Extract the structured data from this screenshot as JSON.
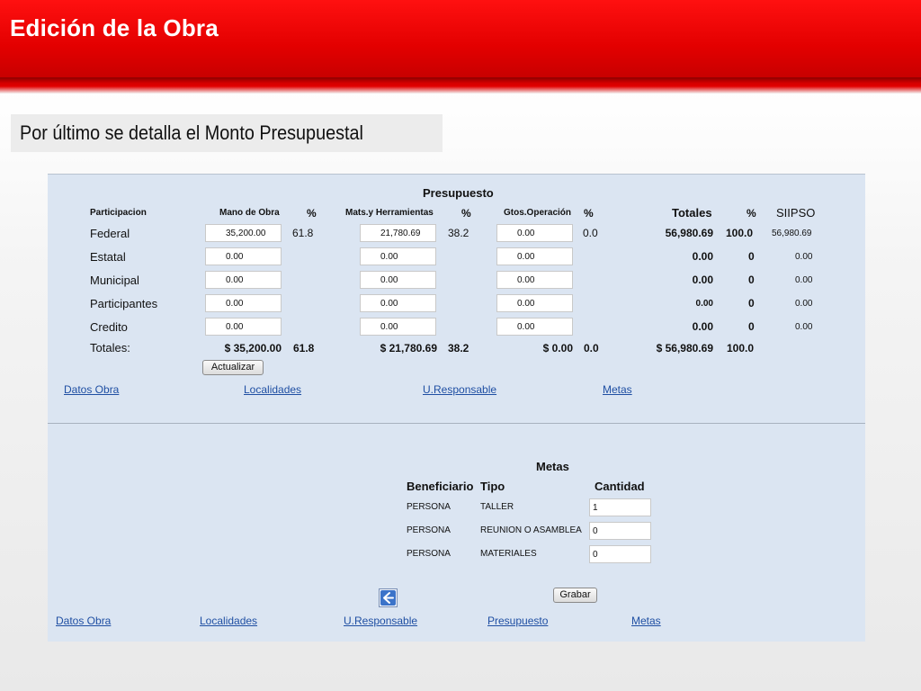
{
  "header": {
    "title": "Edición de la Obra"
  },
  "subtitle": "Por último se detalla el Monto Presupuestal",
  "presupuesto": {
    "title": "Presupuesto",
    "columns": {
      "participacion": "Participacion",
      "mano_obra": "Mano de Obra",
      "pct1": "%",
      "mats": "Mats.y Herramientas",
      "pct2": "%",
      "gtos": "Gtos.Operación",
      "pct3": "%",
      "totales": "Totales",
      "pct4": "%",
      "siipso": "SIIPSO"
    },
    "rows": [
      {
        "label": "Federal",
        "mano_obra": "35,200.00",
        "pct1": "61.8",
        "mats": "21,780.69",
        "pct2": "38.2",
        "gtos": "0.00",
        "pct3": "0.0",
        "total": "56,980.69",
        "pct4": "100.0",
        "siipso": "56,980.69"
      },
      {
        "label": "Estatal",
        "mano_obra": "0.00",
        "mats": "0.00",
        "gtos": "0.00",
        "total": "0.00",
        "pct4": "0",
        "siipso": "0.00"
      },
      {
        "label": "Municipal",
        "mano_obra": "0.00",
        "mats": "0.00",
        "gtos": "0.00",
        "total": "0.00",
        "pct4": "0",
        "siipso": "0.00"
      },
      {
        "label": "Participantes",
        "mano_obra": "0.00",
        "mats": "0.00",
        "gtos": "0.00",
        "total": "0.00",
        "pct4": "0",
        "siipso": "0.00"
      },
      {
        "label": "Credito",
        "mano_obra": "0.00",
        "mats": "0.00",
        "gtos": "0.00",
        "total": "0.00",
        "pct4": "0",
        "siipso": "0.00"
      }
    ],
    "totals": {
      "label": "Totales:",
      "mano_obra": "$ 35,200.00",
      "pct1": "61.8",
      "mats": "$ 21,780.69",
      "pct2": "38.2",
      "gtos": "$ 0.00",
      "pct3": "0.0",
      "total": "$ 56,980.69",
      "pct4": "100.0"
    },
    "update_button": "Actualizar",
    "links": [
      "Datos Obra",
      "Localidades",
      "U.Responsable",
      "Metas"
    ]
  },
  "metas": {
    "title": "Metas",
    "columns": {
      "beneficiario": "Beneficiario",
      "tipo": "Tipo",
      "cantidad": "Cantidad"
    },
    "rows": [
      {
        "beneficiario": "PERSONA",
        "tipo": "TALLER",
        "cantidad": "1"
      },
      {
        "beneficiario": "PERSONA",
        "tipo": "REUNION O ASAMBLEA",
        "cantidad": "0"
      },
      {
        "beneficiario": "PERSONA",
        "tipo": "MATERIALES",
        "cantidad": "0"
      }
    ],
    "save_button": "Grabar",
    "back_icon": "back-arrow-icon",
    "links": [
      "Datos Obra",
      "Localidades",
      "U.Responsable",
      "Presupuesto",
      "Metas"
    ]
  },
  "colors": {
    "header_red": "#e30000",
    "panel_bg": "#dbe5f2",
    "link": "#1f4fa3"
  }
}
